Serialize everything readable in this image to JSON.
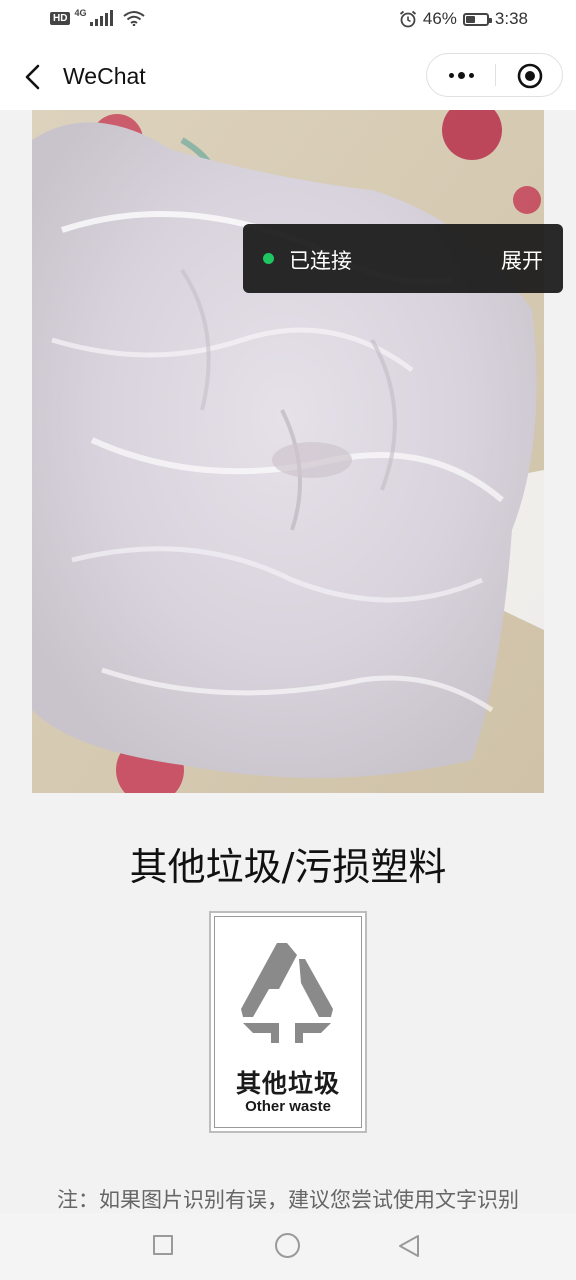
{
  "status_bar": {
    "hd_badge": "HD",
    "network_type": "4G",
    "battery_percent": "46%",
    "battery_level": 0.46,
    "time": "3:38",
    "icons": [
      "signal-icon",
      "wifi-icon",
      "alarm-icon",
      "battery-icon"
    ]
  },
  "nav_bar": {
    "title": "WeChat",
    "icons": [
      "back-arrow-icon",
      "more-dots-icon",
      "close-target-icon"
    ]
  },
  "connection_toast": {
    "status": "已连接",
    "action": "展开",
    "dot_color": "#1fc55f"
  },
  "result": {
    "title": "其他垃圾/污损塑料",
    "bin_label_cn": "其他垃圾",
    "bin_label_en": "Other waste",
    "bin_icon": "other-waste-triangle-icon"
  },
  "note": "注：如果图片识别有误，建议您尝试使用文字识别",
  "system_nav": {
    "icons": [
      "recent-apps-icon",
      "home-icon",
      "back-triangle-icon"
    ]
  }
}
